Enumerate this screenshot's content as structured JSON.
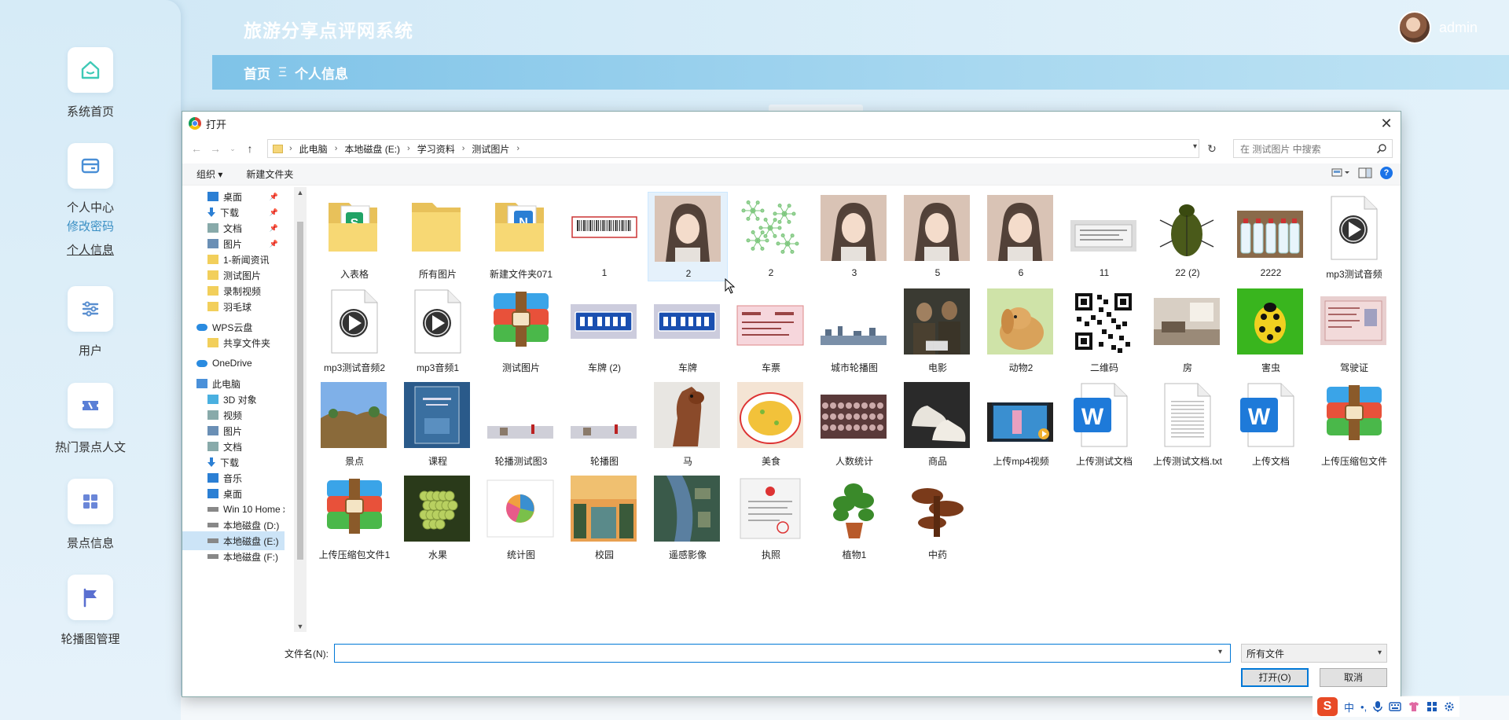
{
  "app": {
    "title": "旅游分享点评网系统",
    "user": "admin"
  },
  "sidebar": {
    "home": "系统首页",
    "personal": "个人中心",
    "change_password": "修改密码",
    "personal_info": "个人信息",
    "users": "用户",
    "hot_spots": "热门景点人文",
    "spot_info": "景点信息",
    "carousel": "轮播图管理"
  },
  "breadcrumb": {
    "home": "首页",
    "sep": "Ξ",
    "current": "个人信息"
  },
  "dialog": {
    "title": "打开",
    "path": [
      "此电脑",
      "本地磁盘 (E:)",
      "学习资料",
      "测试图片"
    ],
    "search_placeholder": "在 测试图片 中搜索",
    "organize": "组织 ▾",
    "new_folder": "新建文件夹",
    "help": "?",
    "tree": [
      {
        "label": "桌面",
        "icon": "desktop-icon",
        "pinned": true
      },
      {
        "label": "下载",
        "icon": "download-icon",
        "pinned": true
      },
      {
        "label": "文档",
        "icon": "document-icon",
        "pinned": true
      },
      {
        "label": "图片",
        "icon": "picture-icon",
        "pinned": true
      },
      {
        "label": "1-新闻资讯",
        "icon": "folder-icon"
      },
      {
        "label": "测试图片",
        "icon": "folder-icon"
      },
      {
        "label": "录制视频",
        "icon": "folder-icon"
      },
      {
        "label": "羽毛球",
        "icon": "folder-icon"
      },
      {
        "label": "WPS云盘",
        "icon": "cloud-icon"
      },
      {
        "label": "共享文件夹",
        "icon": "shared-folder-icon"
      },
      {
        "label": "OneDrive",
        "icon": "cloud-icon"
      },
      {
        "label": "此电脑",
        "icon": "computer-icon"
      },
      {
        "label": "3D 对象",
        "icon": "cube-icon"
      },
      {
        "label": "视频",
        "icon": "video-icon"
      },
      {
        "label": "图片",
        "icon": "picture-icon"
      },
      {
        "label": "文档",
        "icon": "document-icon"
      },
      {
        "label": "下载",
        "icon": "download-icon"
      },
      {
        "label": "音乐",
        "icon": "music-icon"
      },
      {
        "label": "桌面",
        "icon": "desktop-icon"
      },
      {
        "label": "Win 10 Home x",
        "icon": "drive-icon"
      },
      {
        "label": "本地磁盘 (D:)",
        "icon": "drive-icon"
      },
      {
        "label": "本地磁盘 (E:)",
        "icon": "drive-icon",
        "selected": true
      },
      {
        "label": "本地磁盘 (F:)",
        "icon": "drive-icon"
      }
    ],
    "files": [
      {
        "label": "入表格",
        "kind": "folder-green"
      },
      {
        "label": "所有图片",
        "kind": "folder"
      },
      {
        "label": "新建文件夹071",
        "kind": "folder-blue"
      },
      {
        "label": "1",
        "kind": "barcode"
      },
      {
        "label": "2",
        "kind": "portrait",
        "selected": true
      },
      {
        "label": "2",
        "kind": "diagram"
      },
      {
        "label": "3",
        "kind": "portrait"
      },
      {
        "label": "5",
        "kind": "portrait"
      },
      {
        "label": "6",
        "kind": "portrait"
      },
      {
        "label": "11",
        "kind": "certificate"
      },
      {
        "label": "22 (2)",
        "kind": "beetle"
      },
      {
        "label": "2222",
        "kind": "bottles"
      },
      {
        "label": "mp3测试音频",
        "kind": "audio"
      },
      {
        "label": "mp3测试音频2",
        "kind": "audio"
      },
      {
        "label": "mp3音频1",
        "kind": "audio"
      },
      {
        "label": "测试图片",
        "kind": "archive"
      },
      {
        "label": "车牌 (2)",
        "kind": "plate"
      },
      {
        "label": "车牌",
        "kind": "plate"
      },
      {
        "label": "车票",
        "kind": "ticket"
      },
      {
        "label": "城市轮播图",
        "kind": "city"
      },
      {
        "label": "电影",
        "kind": "movie"
      },
      {
        "label": "动物2",
        "kind": "rabbit"
      },
      {
        "label": "二维码",
        "kind": "qrcode"
      },
      {
        "label": "房",
        "kind": "room"
      },
      {
        "label": "害虫",
        "kind": "bug"
      },
      {
        "label": "驾驶证",
        "kind": "license"
      },
      {
        "label": "景点",
        "kind": "landscape"
      },
      {
        "label": "课程",
        "kind": "book"
      },
      {
        "label": "轮播测试图3",
        "kind": "banner"
      },
      {
        "label": "轮播图",
        "kind": "banner"
      },
      {
        "label": "马",
        "kind": "horse"
      },
      {
        "label": "美食",
        "kind": "food"
      },
      {
        "label": "人数统计",
        "kind": "crowd"
      },
      {
        "label": "商品",
        "kind": "shoes"
      },
      {
        "label": "上传mp4视频",
        "kind": "video"
      },
      {
        "label": "上传测试文档",
        "kind": "word"
      },
      {
        "label": "上传测试文档.txt",
        "kind": "text"
      },
      {
        "label": "上传文档",
        "kind": "word"
      },
      {
        "label": "上传压缩包文件",
        "kind": "archive"
      },
      {
        "label": "上传压缩包文件1",
        "kind": "archive"
      },
      {
        "label": "水果",
        "kind": "grapes"
      },
      {
        "label": "统计图",
        "kind": "piechart"
      },
      {
        "label": "校园",
        "kind": "campus"
      },
      {
        "label": "遥感影像",
        "kind": "satellite"
      },
      {
        "label": "执照",
        "kind": "license-doc"
      },
      {
        "label": "植物1",
        "kind": "plant"
      },
      {
        "label": "中药",
        "kind": "mushroom"
      }
    ],
    "filename_label": "文件名(N):",
    "filename_value": "",
    "filetype": "所有文件",
    "open_button": "打开(O)",
    "cancel_button": "取消"
  },
  "ime": {
    "lang": "中",
    "punct": "•,"
  }
}
